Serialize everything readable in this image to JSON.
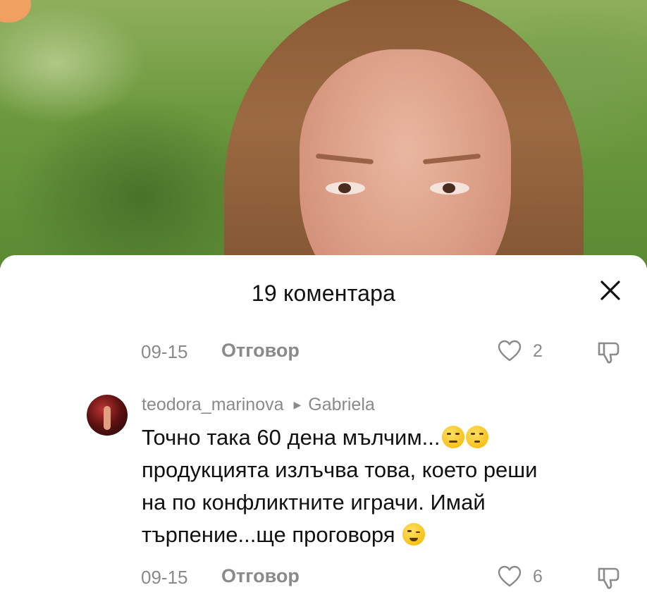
{
  "sheet": {
    "title": "19 коментара"
  },
  "comments": [
    {
      "date": "09-15",
      "reply_label": "Отговор",
      "likes": "2"
    },
    {
      "username": "teodora_marinova",
      "reply_to": "Gabriela",
      "text_line1": "Точно така 60 дена мълчим...",
      "text_line2": "продукцията излъчва това, което реши",
      "text_line3": "на по конфликтните играчи. Имай",
      "text_line4": "търпение...ще проговоря",
      "date": "09-15",
      "reply_label": "Отговор",
      "likes": "6"
    }
  ],
  "colors": {
    "meta_text": "#8a8a8a",
    "body_text": "#111111",
    "sheet_bg": "#ffffff"
  },
  "icons": [
    "close-icon",
    "heart-icon",
    "dislike-icon",
    "unamused-emoji",
    "thinking-emoji",
    "wink-emoji",
    "chevron-right-icon"
  ]
}
